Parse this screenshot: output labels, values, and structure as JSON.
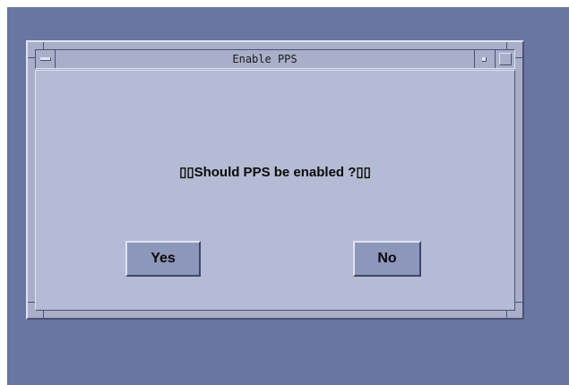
{
  "dialog": {
    "title": "Enable PPS",
    "message": "▯▯Should PPS be enabled ?▯▯",
    "yes_label": "Yes",
    "no_label": "No"
  },
  "colors": {
    "desktop": "#6a75a1",
    "window": "#b5bbd4",
    "button": "#8d96bb"
  }
}
